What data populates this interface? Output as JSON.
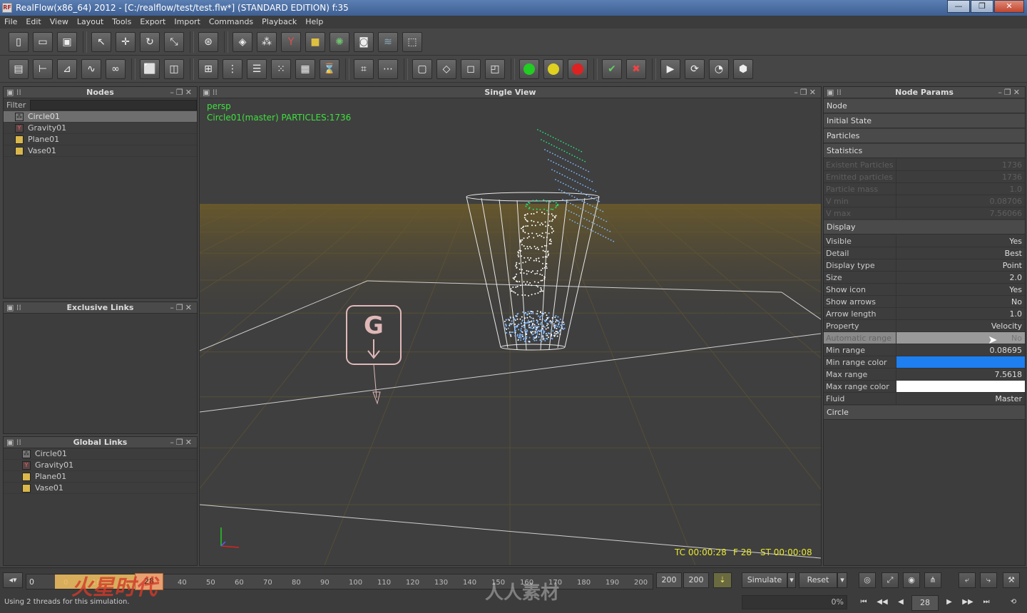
{
  "window": {
    "title": "RealFlow(x86_64) 2012 - [C:/realflow/test/test.flw*] (STANDARD EDITION) f:35",
    "minimize": "—",
    "maximize": "❐",
    "close": "✕"
  },
  "menu": [
    "File",
    "Edit",
    "View",
    "Layout",
    "Tools",
    "Export",
    "Import",
    "Commands",
    "Playback",
    "Help"
  ],
  "nodes_panel": {
    "title": "Nodes",
    "filter_label": "Filter",
    "items": [
      {
        "label": "Circle01",
        "icon": "emitter-icon",
        "selected": true
      },
      {
        "label": "Gravity01",
        "icon": "daemon-icon",
        "selected": false
      },
      {
        "label": "Plane01",
        "icon": "object-icon",
        "selected": false
      },
      {
        "label": "Vase01",
        "icon": "object-icon",
        "selected": false
      }
    ]
  },
  "exclusive_links": {
    "title": "Exclusive Links"
  },
  "global_links": {
    "title": "Global Links",
    "items": [
      "Circle01",
      "Gravity01",
      "Plane01",
      "Vase01"
    ]
  },
  "viewport": {
    "title": "Single View",
    "camera": "persp",
    "node_info": "Circle01(master) PARTICLES:1736",
    "timecode": "TC 00:00:28",
    "frame": "F 28",
    "sim_time": "ST 00:00:08",
    "gravity_label": "G"
  },
  "node_params": {
    "title": "Node Params",
    "sections_top": [
      "Node",
      "Initial State",
      "Particles",
      "Statistics"
    ],
    "statistics": [
      {
        "key": "Existent Particles",
        "value": "1736"
      },
      {
        "key": "Emitted particles",
        "value": "1736"
      },
      {
        "key": "Particle mass",
        "value": "1.0"
      },
      {
        "key": "V min",
        "value": "0.08706"
      },
      {
        "key": "V max",
        "value": "7.56066"
      }
    ],
    "display_section": "Display",
    "display": [
      {
        "key": "Visible",
        "value": "Yes"
      },
      {
        "key": "Detail",
        "value": "Best"
      },
      {
        "key": "Display type",
        "value": "Point"
      },
      {
        "key": "Size",
        "value": "2.0"
      },
      {
        "key": "Show icon",
        "value": "Yes"
      },
      {
        "key": "Show arrows",
        "value": "No"
      },
      {
        "key": "Arrow length",
        "value": "1.0"
      },
      {
        "key": "Property",
        "value": "Velocity"
      },
      {
        "key": "Automatic range",
        "value": "No"
      },
      {
        "key": "Min range",
        "value": "0.08695"
      },
      {
        "key": "Min range color",
        "value": ""
      },
      {
        "key": "Max range",
        "value": "7.5618"
      },
      {
        "key": "Max range color",
        "value": ""
      },
      {
        "key": "Fluid",
        "value": "Master"
      }
    ],
    "min_range_color": "#1e7ff0",
    "max_range_color": "#ffffff",
    "circle_section": "Circle"
  },
  "timeline": {
    "start": "0",
    "current_frame": "28",
    "ticks": [
      "0",
      "10",
      "20",
      "30",
      "40",
      "50",
      "60",
      "70",
      "80",
      "90",
      "100",
      "110",
      "120",
      "130",
      "140",
      "150",
      "160",
      "170",
      "180",
      "190",
      "200"
    ],
    "end_a": "200",
    "end_b": "200",
    "simulate": "Simulate",
    "reset": "Reset",
    "progress": "0%",
    "frame_field": "28"
  },
  "status": "Using 2 threads for this simulation.",
  "watermark": {
    "left": "火星时代",
    "center": "人人素材"
  },
  "colors": {
    "particles_top": "#22e07a",
    "particles_mid": "#ffffff",
    "particles_low": "#7fb8ff",
    "ground": "#6b5a2a"
  }
}
